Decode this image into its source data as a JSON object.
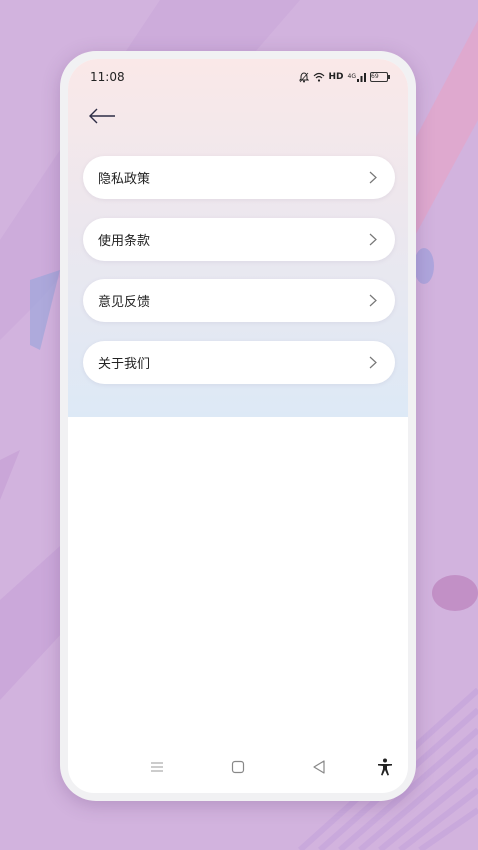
{
  "status_bar": {
    "time": "11:08",
    "network_label": "HD",
    "signal_label": "4G",
    "battery_level": "69"
  },
  "header": {
    "back_icon": "arrow-left-icon"
  },
  "menu": {
    "items": [
      {
        "label": "隐私政策",
        "icon": "chevron-right-icon"
      },
      {
        "label": "使用条款",
        "icon": "chevron-right-icon"
      },
      {
        "label": "意见反馈",
        "icon": "chevron-right-icon"
      },
      {
        "label": "关于我们",
        "icon": "chevron-right-icon"
      }
    ]
  },
  "nav_bar": {
    "buttons": [
      "menu-icon",
      "home-icon",
      "back-triangle-icon",
      "accessibility-icon"
    ]
  },
  "colors": {
    "background": "#d2b3de",
    "header_gradient_top": "#fae8e8",
    "header_gradient_bottom": "#dde9f6",
    "card": "#ffffff",
    "text": "#222222"
  }
}
